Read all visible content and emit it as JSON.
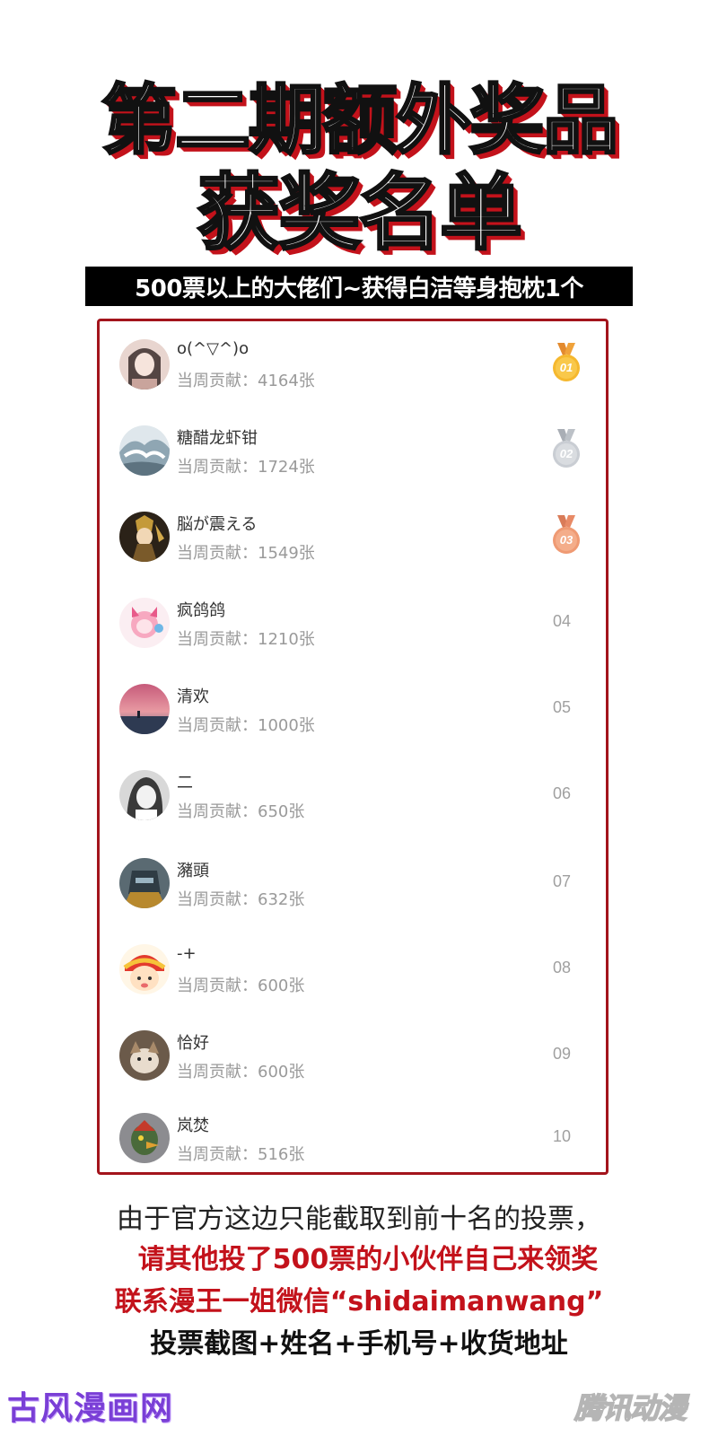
{
  "title_line1": "第二期额外奖品",
  "title_line2": "获奖名单",
  "subtitle": "500票以上的大佬们~获得白洁等身抱枕1个",
  "contribution_prefix": "当周贡献：",
  "entries": [
    {
      "name": "o(^▽^)o",
      "contribution": "当周贡献：4164张",
      "rank": "01",
      "medal": "gold"
    },
    {
      "name": "糖醋龙虾钳",
      "contribution": "当周贡献：1724张",
      "rank": "02",
      "medal": "silver"
    },
    {
      "name": "脳が震える",
      "contribution": "当周贡献：1549张",
      "rank": "03",
      "medal": "bronze"
    },
    {
      "name": "疯鸽鸽",
      "contribution": "当周贡献：1210张",
      "rank": "04"
    },
    {
      "name": "清欢",
      "contribution": "当周贡献：1000张",
      "rank": "05"
    },
    {
      "name": "二",
      "contribution": "当周贡献：650张",
      "rank": "06"
    },
    {
      "name": "瀦頭",
      "contribution": "当周贡献：632张",
      "rank": "07"
    },
    {
      "name": "-+",
      "contribution": "当周贡献：600张",
      "rank": "08"
    },
    {
      "name": "恰好",
      "contribution": "当周贡献：600张",
      "rank": "09"
    },
    {
      "name": "岚焚",
      "contribution": "当周贡献：516张",
      "rank": "10"
    }
  ],
  "notes": {
    "line1": "由于官方这边只能截取到前十名的投票，",
    "line2": "请其他投了500票的小伙伴自己来领奖",
    "line3": "联系漫王一姐微信“shidaimanwang”",
    "line4": "投票截图+姓名+手机号+收货地址"
  },
  "watermarks": {
    "left": "古风漫画网",
    "right": "腾讯动漫"
  },
  "colors": {
    "accent_red": "#c3121b",
    "panel_border": "#a3141c",
    "gold": "#f5b82e",
    "silver": "#c9cdd3",
    "bronze": "#ef9a73"
  }
}
